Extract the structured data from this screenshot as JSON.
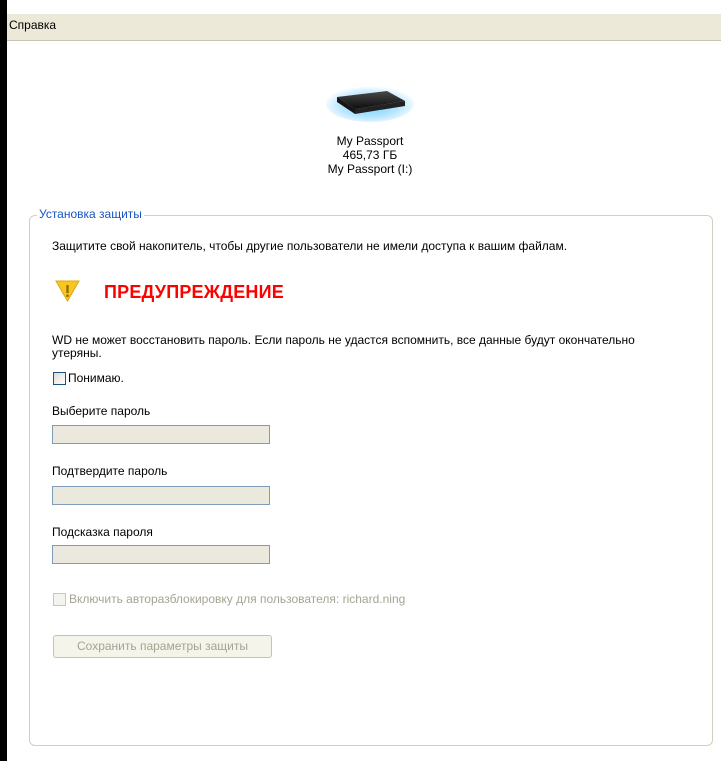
{
  "menu": {
    "help_label": "Справка"
  },
  "device": {
    "name": "My Passport",
    "capacity": "465,73 ГБ",
    "volume": "My Passport (I:)"
  },
  "security": {
    "group_title": "Установка защиты",
    "description": "Защитите свой накопитель, чтобы другие пользователи не имели доступа к вашим файлам.",
    "warning_title": "ПРЕДУПРЕЖДЕНИЕ",
    "warning_line1": "WD не может восстановить пароль. Если пароль не удастся вспомнить, все данные будут окончательно",
    "warning_line2": "утеряны.",
    "understand_label": "Понимаю.",
    "understand_checked": false,
    "password_label": "Выберите пароль",
    "password_value": "",
    "confirm_label": "Подтвердите пароль",
    "confirm_value": "",
    "hint_label": "Подсказка пароля",
    "hint_value": "",
    "autounlock_label": "Включить авторазблокировку для пользователя: richard.ning",
    "autounlock_enabled": false,
    "save_button_label": "Сохранить параметры защиты",
    "save_button_enabled": false
  },
  "colors": {
    "warning_red": "#ff0000",
    "legend_blue": "#1455c4",
    "warning_icon_yellow": "#f7c623",
    "disabled_text": "#a5a392"
  },
  "icons": {
    "device": "external-drive-icon",
    "warning": "warning-shield-icon"
  }
}
